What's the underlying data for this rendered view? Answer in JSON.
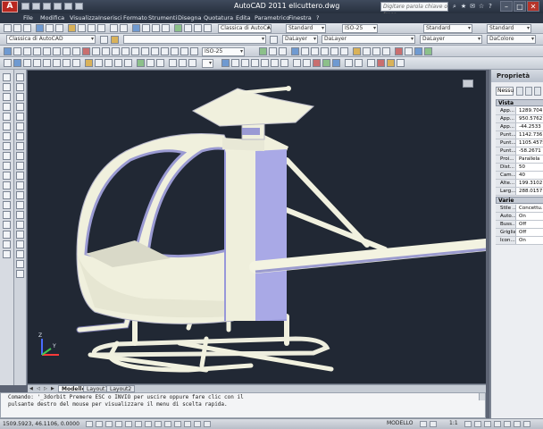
{
  "window": {
    "title": "AutoCAD 2011   elicuttero.dwg",
    "search_placeholder": "Digitare parola chiave o frase",
    "logo": "A"
  },
  "menu": [
    "File",
    "Modifica",
    "Visualizza",
    "Inserisci",
    "Formato",
    "Strumenti",
    "Disegna",
    "Quotatura",
    "Edita",
    "Parametrico",
    "Finestra",
    "?"
  ],
  "toolbars": {
    "workspace": "Classica di AutoCAD",
    "standard_1": "Standard",
    "iso": "ISO-25",
    "standard_2": "Standard",
    "standard_3": "Standard",
    "layer_current": "Classica di AutoCAD",
    "bylayer_1": "DaLayer",
    "bylayer_2": "DaLayer",
    "bylayer_3": "DaLayer",
    "bycolor": "DaColore",
    "iso_2": "ISO-25",
    "blank_1": "",
    "blank_2": ""
  },
  "tabs": [
    "Modello",
    "Layout1",
    "Layout2"
  ],
  "command": {
    "line1": "Comando: '_3dorbit Premere ESC o INVIO per uscire oppure fare clic con il",
    "line2": "pulsante destro del mouse per visualizzare il menu di scelta rapida."
  },
  "status": {
    "coords": "1509.5923, 46.1106, 0.0000",
    "model": "MODELLO",
    "scale": "1:1"
  },
  "properties": {
    "title": "Proprietà",
    "selection": "Nessu",
    "sections": [
      {
        "name": "Vista",
        "rows": [
          {
            "label": "App...",
            "value": "1289.704"
          },
          {
            "label": "App...",
            "value": "950.5762"
          },
          {
            "label": "App...",
            "value": "-44.2533"
          },
          {
            "label": "Punt...",
            "value": "1142.736"
          },
          {
            "label": "Punt...",
            "value": "1105.4575"
          },
          {
            "label": "Punt...",
            "value": "-58.2671"
          },
          {
            "label": "Proi...",
            "value": "Parallela"
          },
          {
            "label": "Dist...",
            "value": "50"
          },
          {
            "label": "Cam...",
            "value": "40"
          },
          {
            "label": "Alte...",
            "value": "199.3102"
          },
          {
            "label": "Larg...",
            "value": "288.0157"
          }
        ]
      },
      {
        "name": "Varie",
        "rows": [
          {
            "label": "Stile ...",
            "value": "Concettu..."
          },
          {
            "label": "Auto...",
            "value": "On"
          },
          {
            "label": "Buss...",
            "value": "Off"
          },
          {
            "label": "Griglia",
            "value": "Off"
          },
          {
            "label": "Icon...",
            "value": "On"
          }
        ]
      }
    ]
  },
  "ucs": {
    "y": "Y",
    "z": "Z"
  },
  "colors": {
    "model_light": "#f1f1df",
    "model_shadow": "#9797d9",
    "background": "#212834"
  }
}
